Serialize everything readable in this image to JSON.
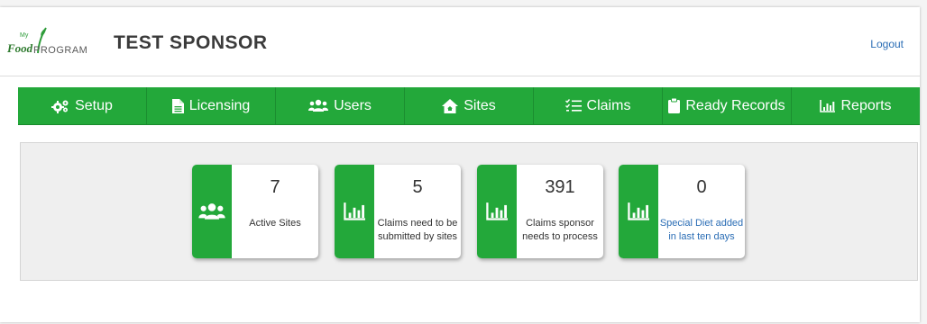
{
  "header": {
    "logo": {
      "my": "My",
      "food": "Food",
      "program": "PROGRAM"
    },
    "title": "TEST SPONSOR",
    "logout_label": "Logout"
  },
  "nav": {
    "items": [
      {
        "label": "Setup",
        "icon": "gears-icon"
      },
      {
        "label": "Licensing",
        "icon": "document-icon"
      },
      {
        "label": "Users",
        "icon": "users-icon"
      },
      {
        "label": "Sites",
        "icon": "house-icon"
      },
      {
        "label": "Claims",
        "icon": "checklist-icon"
      },
      {
        "label": "Ready Records",
        "icon": "clipboard-icon"
      },
      {
        "label": "Reports",
        "icon": "bar-chart-icon"
      }
    ]
  },
  "cards": [
    {
      "value": "7",
      "label": "Active Sites",
      "icon": "users-icon"
    },
    {
      "value": "5",
      "label": "Claims need to be submitted by sites",
      "icon": "bar-chart-icon"
    },
    {
      "value": "391",
      "label": "Claims sponsor needs to process",
      "icon": "bar-chart-icon"
    },
    {
      "value": "0",
      "label": "Special Diet added in last ten days",
      "icon": "bar-chart-icon"
    }
  ],
  "colors": {
    "accent": "#23a83a",
    "link": "#2a6db5",
    "brand_text": "#3b3b3b"
  }
}
